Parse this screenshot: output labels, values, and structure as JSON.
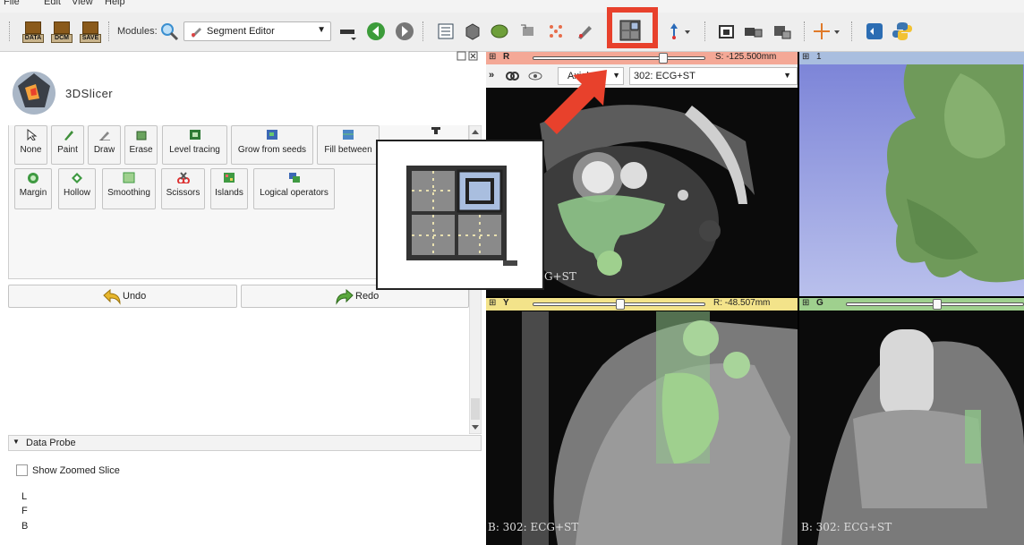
{
  "menu": [
    "File",
    "Edit",
    "View",
    "Help"
  ],
  "toolbar": {
    "data_label": "DATA",
    "dcm_label": "DCM",
    "save_label": "SAVE",
    "modules_label": "Modules:",
    "module_selected": "Segment Editor"
  },
  "app": {
    "logo_text": "3DSlicer"
  },
  "effects_row1": [
    "None",
    "Paint",
    "Draw",
    "Erase",
    "Level tracing",
    "Grow from seeds",
    "Fill between"
  ],
  "effects_row2": [
    "Margin",
    "Hollow",
    "Smoothing",
    "Scissors",
    "Islands",
    "Logical operators"
  ],
  "actions": {
    "undo": "Undo",
    "redo": "Redo"
  },
  "data_probe": {
    "title": "Data Probe",
    "show_zoomed_slice": "Show Zoomed Slice",
    "coords": [
      "L",
      "F",
      "B"
    ]
  },
  "views": {
    "red": {
      "letter": "R",
      "offset": "S: -125.500mm",
      "orientation": "Axial",
      "volume": "302: ECG+ST",
      "label": "G+ST",
      "color": "#f4a896"
    },
    "threed": {
      "number": "1",
      "color": "#a9bedf"
    },
    "yellow": {
      "letter": "Y",
      "offset": "R: -48.507mm",
      "label": "B: 302: ECG+ST",
      "color": "#f3e38a"
    },
    "green": {
      "letter": "G",
      "label": "B: 302: ECG+ST",
      "color": "#9fd08e"
    }
  },
  "colors": {
    "highlight": "#e8412c",
    "segment": "#8fc58a",
    "toolbar_bg": "#eeeeee"
  }
}
